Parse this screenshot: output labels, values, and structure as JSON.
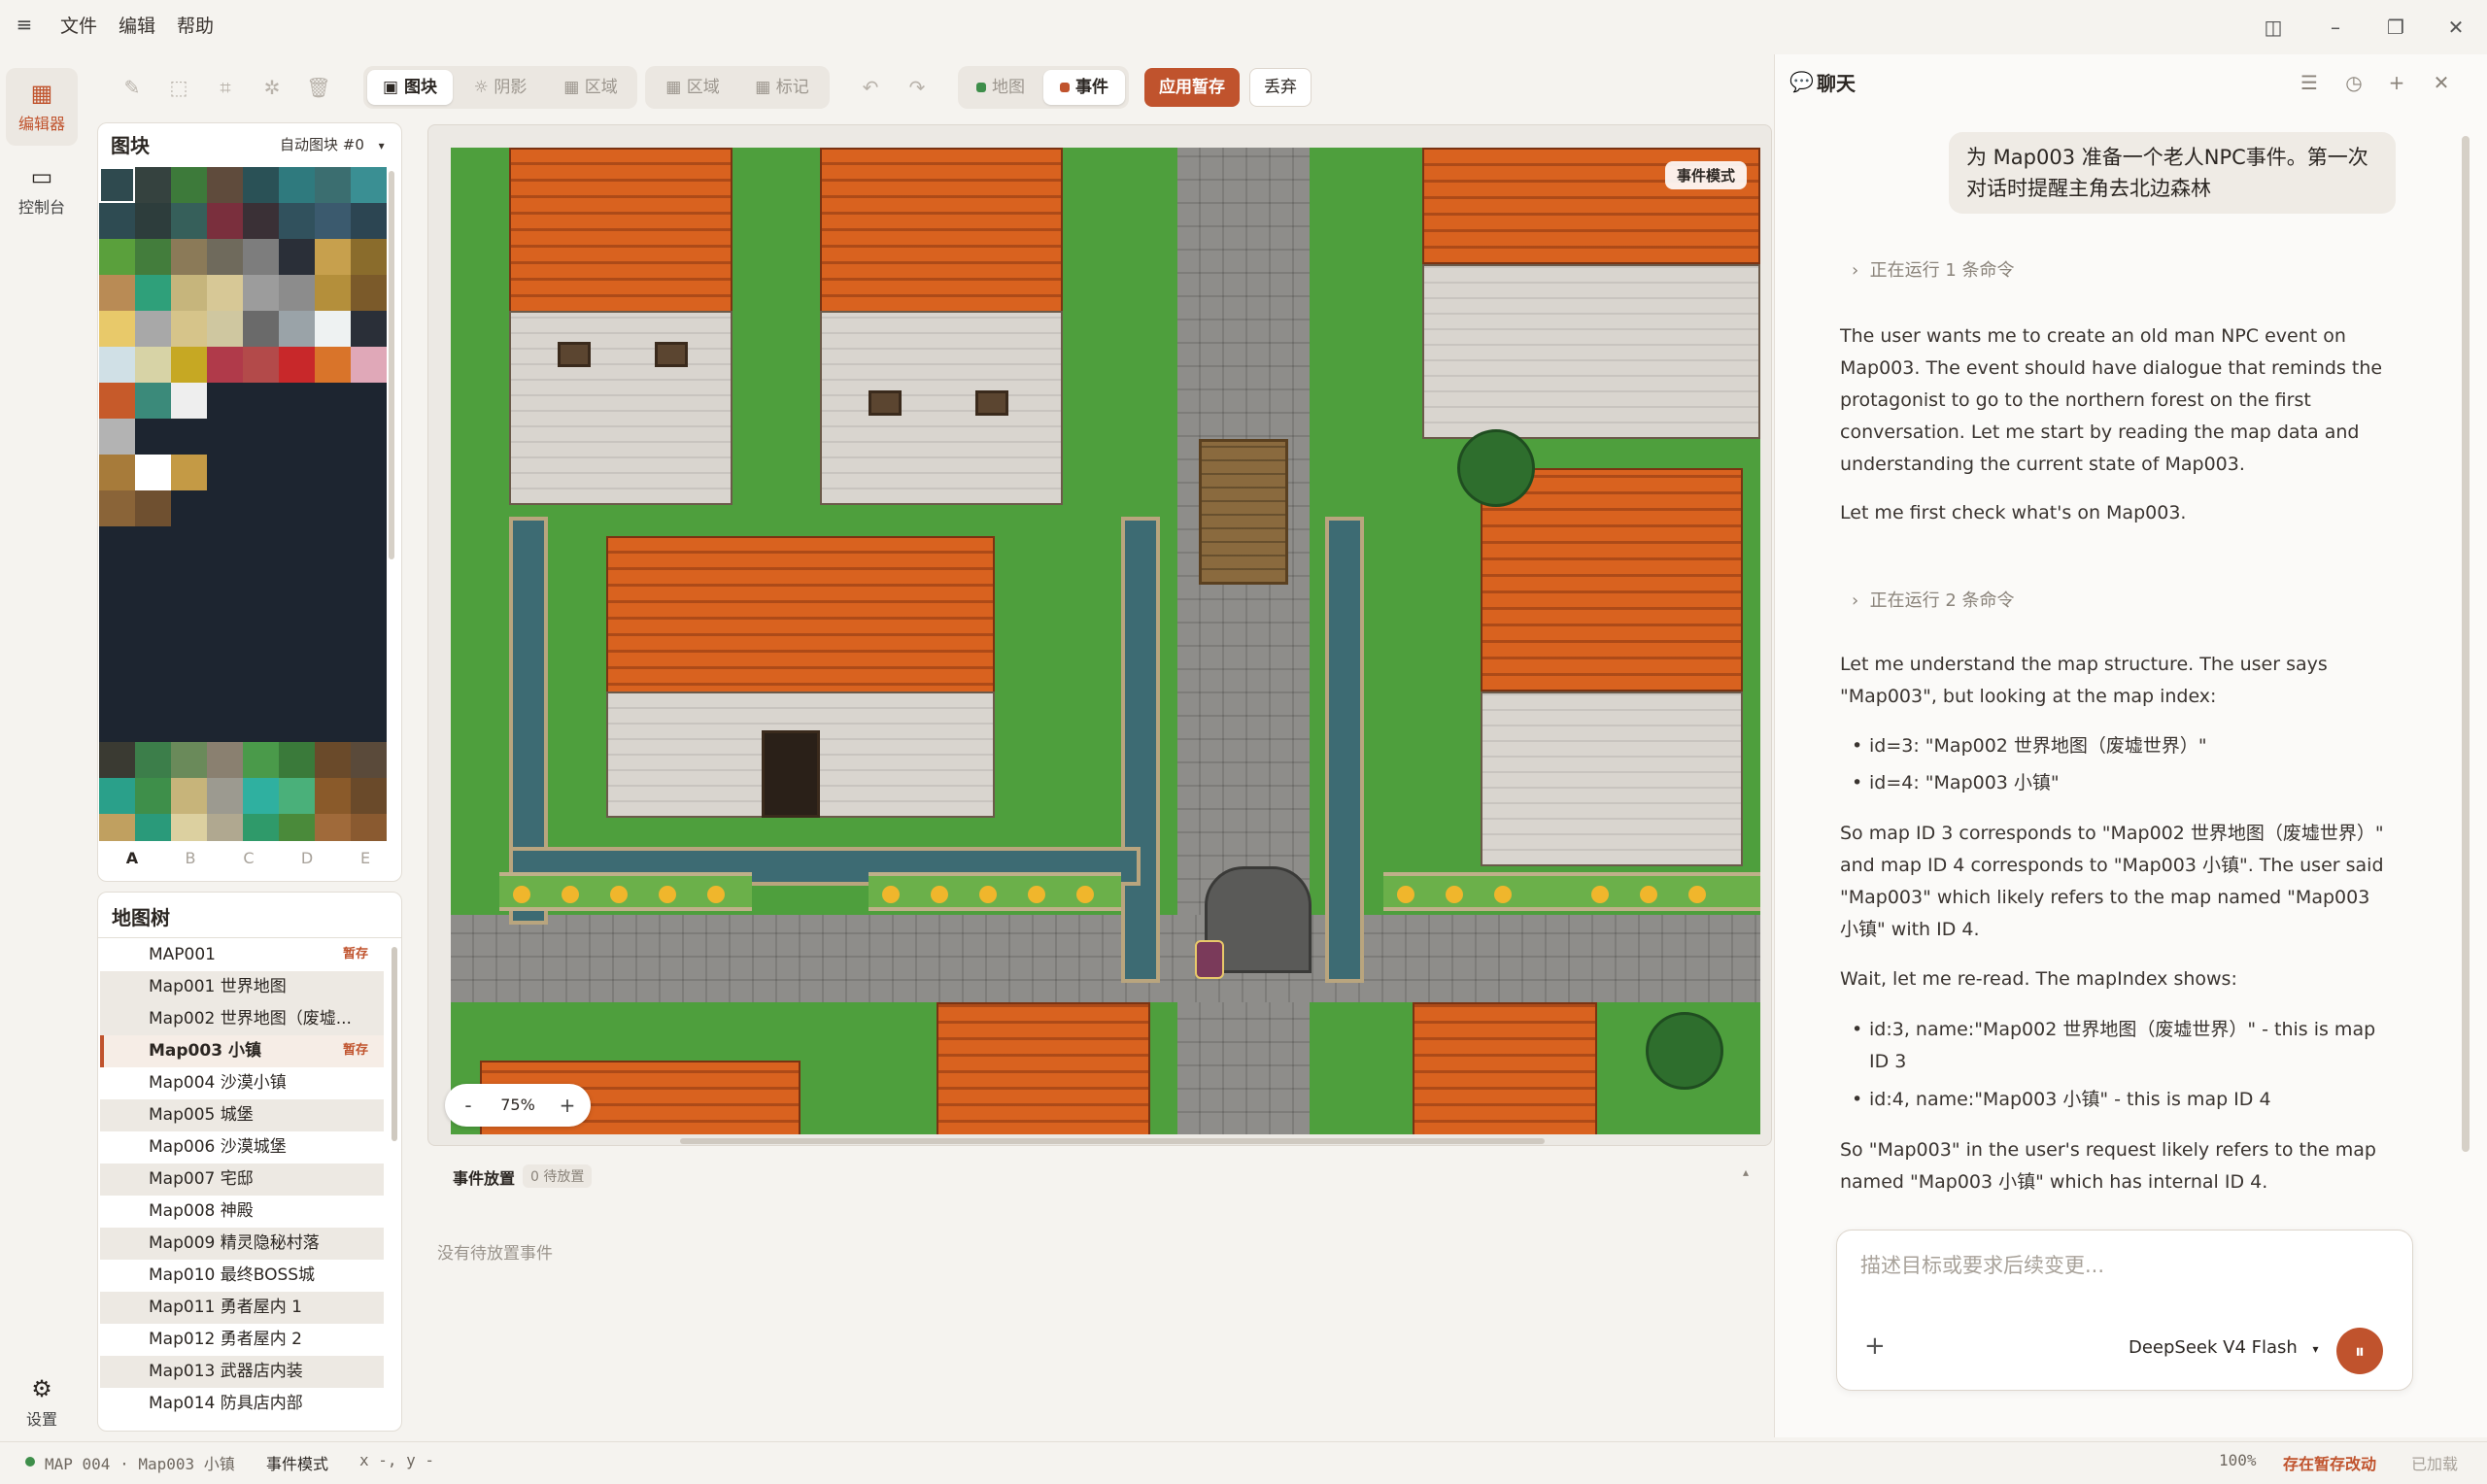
{
  "menu": {
    "items": [
      "文件",
      "编辑",
      "帮助"
    ]
  },
  "rail": {
    "editor_label": "编辑器",
    "console_label": "控制台",
    "settings_label": "设置"
  },
  "toolbar": {
    "layer_tile": "图块",
    "layer_shadow": "阴影",
    "layer_region": "区域",
    "view_region": "区域",
    "view_mark": "标记",
    "mode_map": "地图",
    "mode_event": "事件",
    "apply": "应用暂存",
    "discard": "丢弃"
  },
  "tiles": {
    "title": "图块",
    "autotile": "自动图块 #0",
    "tabs": [
      "A",
      "B",
      "C",
      "D",
      "E"
    ]
  },
  "map_tree": {
    "title": "地图树",
    "items": [
      {
        "name": "MAP001",
        "badge": "暂存"
      },
      {
        "name": "Map001 世界地图",
        "badge": ""
      },
      {
        "name": "Map002 世界地图（废墟...",
        "badge": ""
      },
      {
        "name": "Map003 小镇",
        "badge": "暂存"
      },
      {
        "name": "Map004 沙漠小镇",
        "badge": ""
      },
      {
        "name": "Map005 城堡",
        "badge": ""
      },
      {
        "name": "Map006 沙漠城堡",
        "badge": ""
      },
      {
        "name": "Map007 宅邸",
        "badge": ""
      },
      {
        "name": "Map008 神殿",
        "badge": ""
      },
      {
        "name": "Map009 精灵隐秘村落",
        "badge": ""
      },
      {
        "name": "Map010 最终BOSS城",
        "badge": ""
      },
      {
        "name": "Map011 勇者屋内 1",
        "badge": ""
      },
      {
        "name": "Map012 勇者屋内 2",
        "badge": ""
      },
      {
        "name": "Map013 武器店内装",
        "badge": ""
      },
      {
        "name": "Map014 防具店内部",
        "badge": ""
      }
    ]
  },
  "map": {
    "mode_badge": "事件模式",
    "zoom": "75%"
  },
  "events": {
    "title": "事件放置",
    "count": "0 待放置",
    "empty": "没有待放置事件"
  },
  "chat": {
    "title": "聊天",
    "user_message": "为 Map003 准备一个老人NPC事件。第一次对话时提醒主角去北边森林",
    "cmd1": "正在运行 1 条命令",
    "cmd2": "正在运行 2 条命令",
    "p1": "The user wants me to create an old man NPC event on Map003. The event should have dialogue that reminds the protagonist to go to the northern forest on the first conversation. Let me start by reading the map data and understanding the current state of Map003.",
    "p2": "Let me first check what's on Map003.",
    "p3": "Let me understand the map structure. The user says \"Map003\", but looking at the map index:",
    "li1": "id=3: \"Map002 世界地图（废墟世界）\"",
    "li2": "id=4: \"Map003 小镇\"",
    "p4": "So map ID 3 corresponds to \"Map002 世界地图（废墟世界）\" and map ID 4 corresponds to \"Map003 小镇\". The user said \"Map003\" which likely refers to the map named \"Map003 小镇\" with ID 4.",
    "p5": "Wait, let me re-read. The mapIndex shows:",
    "li3": "id:3, name:\"Map002 世界地图（废墟世界）\" - this is map ID 3",
    "li4": "id:4, name:\"Map003 小镇\" - this is map ID 4",
    "p6": "So \"Map003\" in the user's request likely refers to the map named \"Map003 小镇\" which has internal ID 4.",
    "placeholder": "描述目标或要求后续变更...",
    "model": "DeepSeek V4 Flash"
  },
  "status": {
    "map_info": "MAP 004 · Map003 小镇",
    "mode": "事件模式",
    "coords": "x -, y -",
    "zoom": "100%",
    "unsaved": "存在暂存改动",
    "loaded": "已加载"
  },
  "colors": {
    "accent": "#c0532d",
    "grass": "#4e9f3d",
    "roof": "#d9621f"
  }
}
